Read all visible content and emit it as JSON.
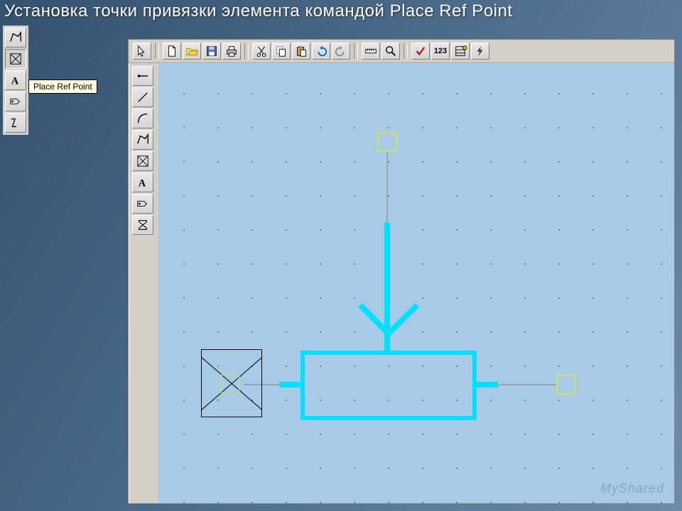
{
  "title": "Установка точки привязки элемента командой Place Ref Point",
  "tooltip": "Place Ref Point",
  "watermark": "MyShared",
  "horiz_toolbar": {
    "buttons": [
      "pointer",
      "new",
      "open",
      "save",
      "print",
      "cut",
      "copy",
      "paste",
      "undo",
      "redo",
      "ruler",
      "zoom",
      "check",
      "123",
      "options",
      "lightning"
    ],
    "label_123": "123"
  },
  "vert_toolbar": {
    "buttons": [
      "wire",
      "line",
      "arc",
      "polygon",
      "refpoint",
      "text",
      "tag",
      "sigma"
    ]
  },
  "palette1": {
    "buttons": [
      "polygon",
      "refpoint",
      "text",
      "tag",
      "misc"
    ]
  },
  "colors": {
    "canvas_bg": "#a7cbe6",
    "schematic_trace": "#00e0ff",
    "pin_outline": "#cde05a",
    "ref_outline": "#000000"
  }
}
